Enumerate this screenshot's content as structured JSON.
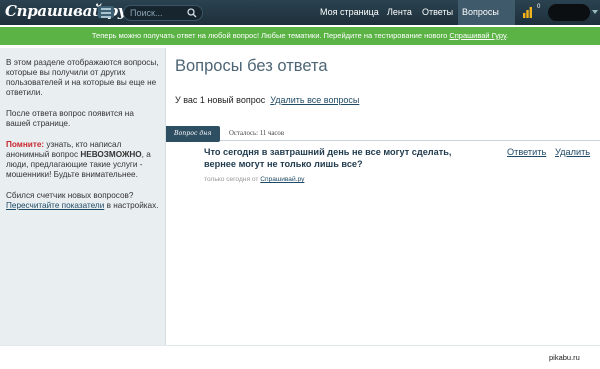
{
  "header": {
    "logo": "Спрашивай.ру",
    "search_placeholder": "Поиск...",
    "nav": [
      {
        "label": "Моя страница"
      },
      {
        "label": "Лента"
      },
      {
        "label": "Ответы"
      },
      {
        "label": "Вопросы",
        "badge": "1",
        "active": true
      }
    ],
    "stats_count": "0"
  },
  "banner": {
    "text": "Теперь можно получать ответ на любой вопрос! Любые тематики. Перейдите на тестирование нового ",
    "link": "Спрашивай Гуру",
    "end": "."
  },
  "sidebar": {
    "p1": "В этом разделе отображаются вопросы, которые вы получили от других пользователей и на которые вы еще не ответили.",
    "p2": "После ответа вопрос появится на вашей странице.",
    "warn_label": "Помните:",
    "warn_text_1": " узнать, кто написал анонимный вопрос ",
    "warn_strong": "НЕВОЗМОЖНО",
    "warn_text_2": ", а люди, предлагающие такие услуги - мошенники! Будьте внимательнее.",
    "p4_text": "Сбился счетчик новых вопросов?",
    "p4_link": "Пересчитайте показатели",
    "p4_end": " в настройках."
  },
  "main": {
    "title": "Вопросы без ответа",
    "count_text": "У вас 1 новый вопрос",
    "delete_all": "Удалить все вопросы",
    "question": {
      "tag": "Вопрос дня",
      "time_left": "Осталось: 11 часов",
      "text": "Что сегодня в завтрашний день не все могут сделать, вернее могут не только лишь все?",
      "answer_label": "Ответить",
      "delete_label": "Удалить",
      "meta_text": "только сегодня от ",
      "meta_author": "Спрашивай.ру"
    }
  },
  "watermark": "pikabu.ru",
  "colors": {
    "topbar": "#1d303b",
    "banner": "#5bb346",
    "badge": "#e8721c",
    "tag": "#2e4e62",
    "warning": "#c7282e",
    "link": "#1f4a66"
  }
}
